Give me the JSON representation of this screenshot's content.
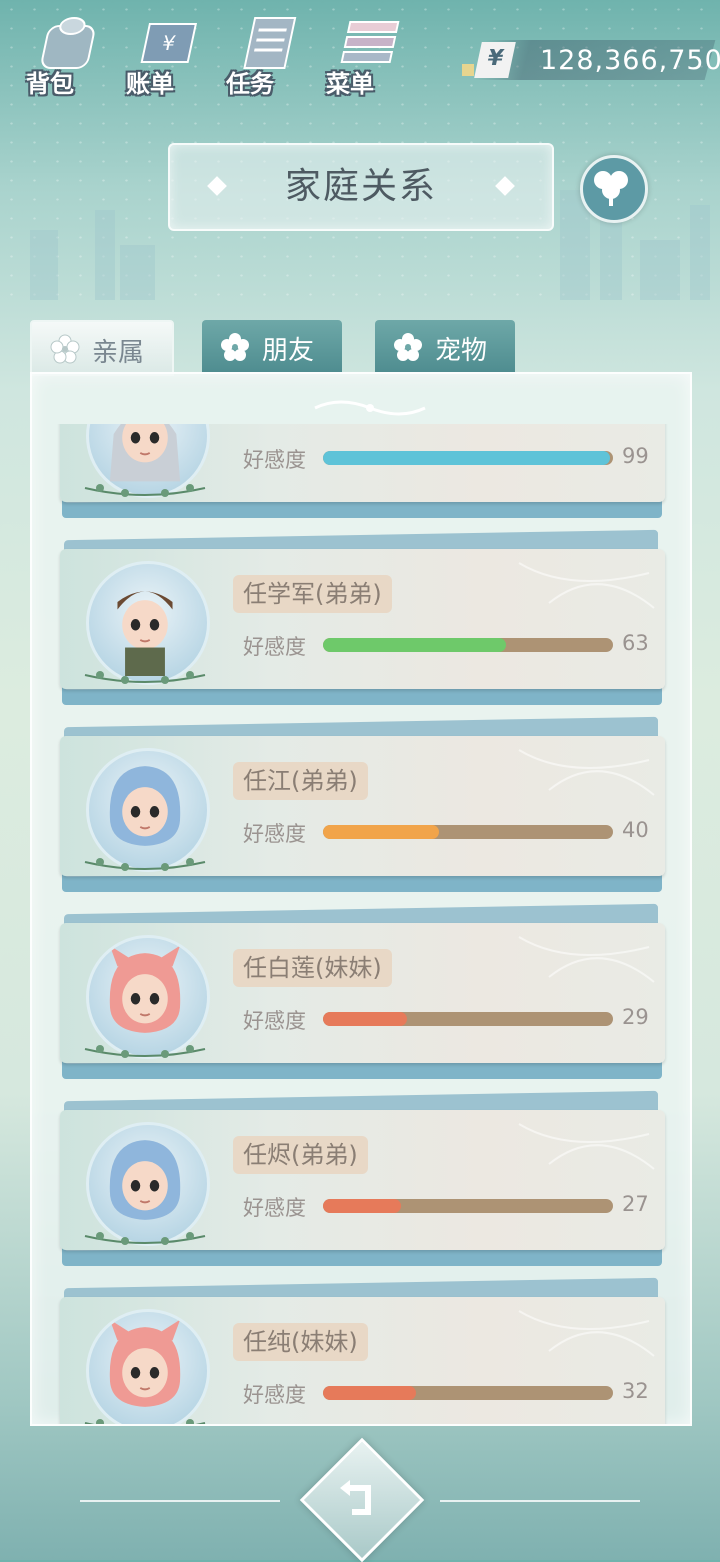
{
  "topbar": {
    "nav": [
      {
        "label": "背包",
        "icon": "bag-icon"
      },
      {
        "label": "账单",
        "icon": "bill-icon"
      },
      {
        "label": "任务",
        "icon": "task-icon"
      },
      {
        "label": "菜单",
        "icon": "menu-icon"
      }
    ],
    "money": {
      "currency_symbol": "¥",
      "value": "128,366,750"
    }
  },
  "header": {
    "title": "家庭关系",
    "family_icon": "family-tree-icon"
  },
  "tabs": [
    {
      "label": "亲属",
      "active": true,
      "icon": "flower-icon"
    },
    {
      "label": "朋友",
      "active": false,
      "icon": "flower-icon"
    },
    {
      "label": "宠物",
      "active": false,
      "icon": "flower-icon"
    }
  ],
  "relations": {
    "affinity_label": "好感度",
    "items": [
      {
        "name": "",
        "affinity": 99,
        "bar_color": "#5ec3d8",
        "avatar": "girl-veil-avatar"
      },
      {
        "name": "任学军(弟弟)",
        "affinity": 63,
        "bar_color": "#6ec96a",
        "avatar": "boy-brown-hair-avatar"
      },
      {
        "name": "任江(弟弟)",
        "affinity": 40,
        "bar_color": "#f1a44a",
        "avatar": "blue-dino-hood-avatar"
      },
      {
        "name": "任白莲(妹妹)",
        "affinity": 29,
        "bar_color": "#e67a5a",
        "avatar": "pink-hood-avatar"
      },
      {
        "name": "任烬(弟弟)",
        "affinity": 27,
        "bar_color": "#e67a5a",
        "avatar": "blue-hood-avatar"
      },
      {
        "name": "任纯(妹妹)",
        "affinity": 32,
        "bar_color": "#e67a5a",
        "avatar": "pink-hood-avatar"
      }
    ]
  },
  "footer": {
    "back_icon": "back-arrow-icon"
  }
}
